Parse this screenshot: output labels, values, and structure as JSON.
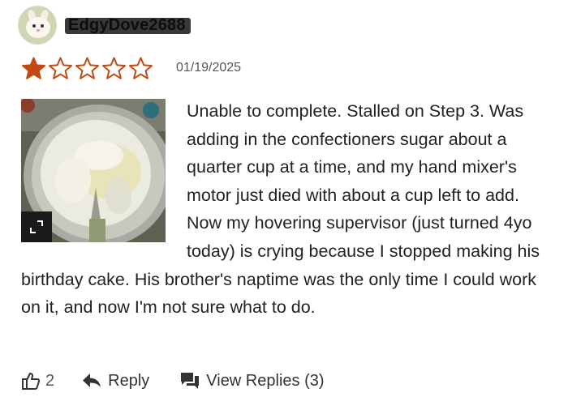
{
  "review": {
    "username": "EdgyDove2688",
    "rating": 1,
    "max_rating": 5,
    "date": "01/19/2025",
    "text": "Unable to complete. Stalled on Step 3. Was adding in the confectioners sugar about a quarter cup at a time, and my hand mixer's motor just died with about a cup left to add. Now my hovering supervisor (just turned 4yo today) is crying because I stopped making his birthday cake. His brother's naptime was the only time I could work on it, and now I'm not sure what to do."
  },
  "actions": {
    "like_count": "2",
    "reply_label": "Reply",
    "view_replies_label": "View Replies (3)"
  },
  "icons": {
    "star_filled": "star-filled-icon",
    "star_empty": "star-outline-icon",
    "expand": "expand-icon",
    "like": "thumbs-up-icon",
    "reply": "reply-arrow-icon",
    "replies": "chat-bubbles-icon"
  },
  "colors": {
    "star": "#c24a12",
    "username": "#3b3b3b",
    "text": "#222222"
  }
}
